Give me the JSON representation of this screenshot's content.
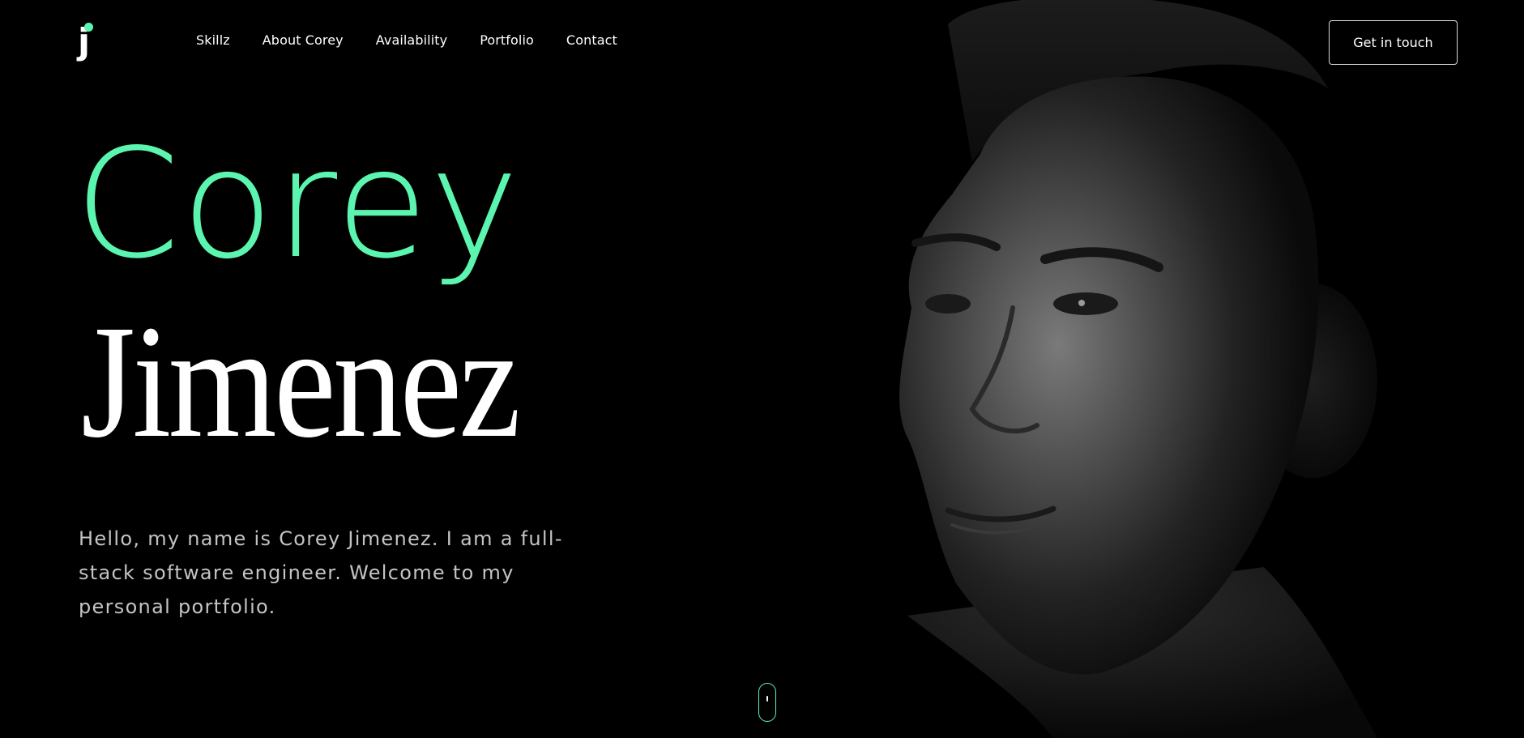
{
  "logo": {
    "letter": "j",
    "accent_color": "#5cf5b0"
  },
  "nav": {
    "items": [
      {
        "label": "Skillz"
      },
      {
        "label": "About Corey"
      },
      {
        "label": "Availability"
      },
      {
        "label": "Portfolio"
      },
      {
        "label": "Contact"
      }
    ]
  },
  "cta": {
    "label": "Get in touch"
  },
  "hero": {
    "first_name": "Corey",
    "last_name": "Jimenez",
    "intro": "Hello, my name is Corey Jimenez. I am a full-stack software engineer. Welcome to my personal portfolio."
  },
  "theme": {
    "background": "#000000",
    "accent": "#5cf5b0",
    "text": "#ffffff",
    "muted_text": "#c4c4c4"
  },
  "scroll_indicator": {
    "icon": "mouse-scroll-icon"
  },
  "portrait": {
    "icon": "portrait-photo"
  }
}
